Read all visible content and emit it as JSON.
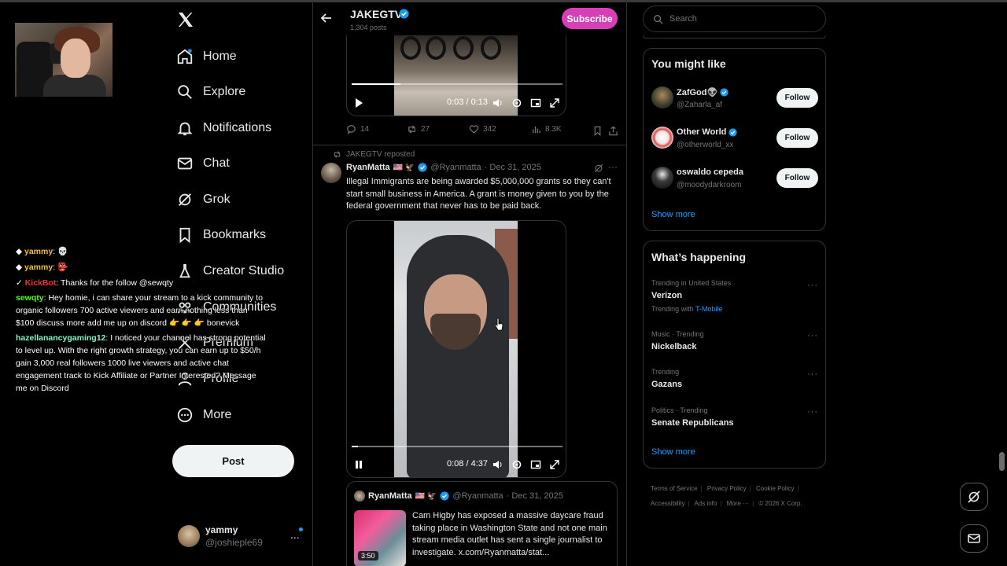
{
  "nav": {
    "items": [
      {
        "label": "Home",
        "icon": "home-icon"
      },
      {
        "label": "Explore",
        "icon": "search-icon"
      },
      {
        "label": "Notifications",
        "icon": "bell-icon"
      },
      {
        "label": "Chat",
        "icon": "mail-icon"
      },
      {
        "label": "Grok",
        "icon": "grok-icon"
      },
      {
        "label": "Bookmarks",
        "icon": "bookmark-icon"
      },
      {
        "label": "Creator Studio",
        "icon": "flask-icon"
      },
      {
        "label": "Communities",
        "icon": "communities-icon"
      },
      {
        "label": "Premium",
        "icon": "x-premium-icon"
      },
      {
        "label": "Profile",
        "icon": "person-icon"
      },
      {
        "label": "More",
        "icon": "more-circle-icon"
      }
    ],
    "post_label": "Post",
    "account": {
      "name": "yammy",
      "handle": "@joshieple69",
      "more": "..."
    }
  },
  "chat": {
    "messages": [
      {
        "user": "yammy",
        "text": ": 💀"
      },
      {
        "user": "yammy",
        "text": ": 👺"
      },
      {
        "user": "KickBot",
        "text": ": Thanks for the follow @sewqty"
      },
      {
        "user": "sewqty",
        "text": ": Hey homie, i can share your stream to a kick community to organic followers 700 active viewers and earn nothing less than $100 discuss more add me up on discord 👉 👉 👉 bonevick"
      },
      {
        "user": "hazellanancygaming12",
        "text": ": I noticed your channel has strong potential to level up. With the right growth strategy, you can earn up to $50/h gain 3,000 real followers 1000 live viewers and active chat engagement track to Kick Affiliate or Partner Interested? Message me on Discord"
      }
    ]
  },
  "header": {
    "title": "JAKEGTV",
    "posts_count": "1,304 posts",
    "subscribe_label": "Subscribe"
  },
  "video1": {
    "time": "0:03 / 0:13",
    "progress": 0.23
  },
  "actions": {
    "replies": "14",
    "reposts": "27",
    "likes": "342",
    "views": "8.3K"
  },
  "tweet": {
    "repost_by": "JAKEGTV reposted",
    "name": "RyanMatta",
    "flags": "🇺🇸 🦅",
    "handle": "@Ryanmatta",
    "date": "· Dec 31, 2025",
    "text": "Illegal Immigrants are being awarded $5,000,000 grants so they can't start small business in America. A grant is money given to you by the federal government that never has to be paid back."
  },
  "video2": {
    "time": "0:08 / 4:37",
    "progress": 0.03
  },
  "quote": {
    "name": "RyanMatta",
    "flags": "🇺🇸 🦅",
    "handle": "@Ryanmatta",
    "date": "· Dec 31, 2025",
    "duration": "3:50",
    "text": "Cam Higby has exposed a massive daycare fraud taking place in Washington State and not one main stream media outlet has sent a single journalist to investigate.  x.com/Ryanmatta/stat..."
  },
  "search": {
    "placeholder": "Search"
  },
  "suggestions": {
    "title": "You might like",
    "items": [
      {
        "name": "ZafGod👽",
        "handle": "@Zaharla_af",
        "follow": "Follow"
      },
      {
        "name": "Other World",
        "handle": "@otherworld_xx",
        "follow": "Follow"
      },
      {
        "name": "oswaldo cepeda",
        "handle": "@moodydarkroom",
        "follow": "Follow"
      }
    ],
    "show_more": "Show more"
  },
  "trends": {
    "title": "What’s happening",
    "items": [
      {
        "meta": "Trending in United States",
        "name": "Verizon",
        "sub_prefix": "Trending with ",
        "sub_link": "T-Mobile"
      },
      {
        "meta": "Music · Trending",
        "name": "Nickelback"
      },
      {
        "meta": "Trending",
        "name": "Gazans"
      },
      {
        "meta": "Politics · Trending",
        "name": "Senate Republicans"
      }
    ],
    "show_more": "Show more",
    "dots": "···"
  },
  "footer": {
    "links": [
      "Terms of Service",
      "Privacy Policy",
      "Cookie Policy",
      "Accessibility",
      "Ads info",
      "More ···",
      "© 2026 X Corp."
    ]
  },
  "colors": {
    "accent": "#1d9bf0",
    "subscribe": "#d63fb5",
    "background": "#000000",
    "text": "#e7e9ea",
    "muted": "#71767b"
  }
}
